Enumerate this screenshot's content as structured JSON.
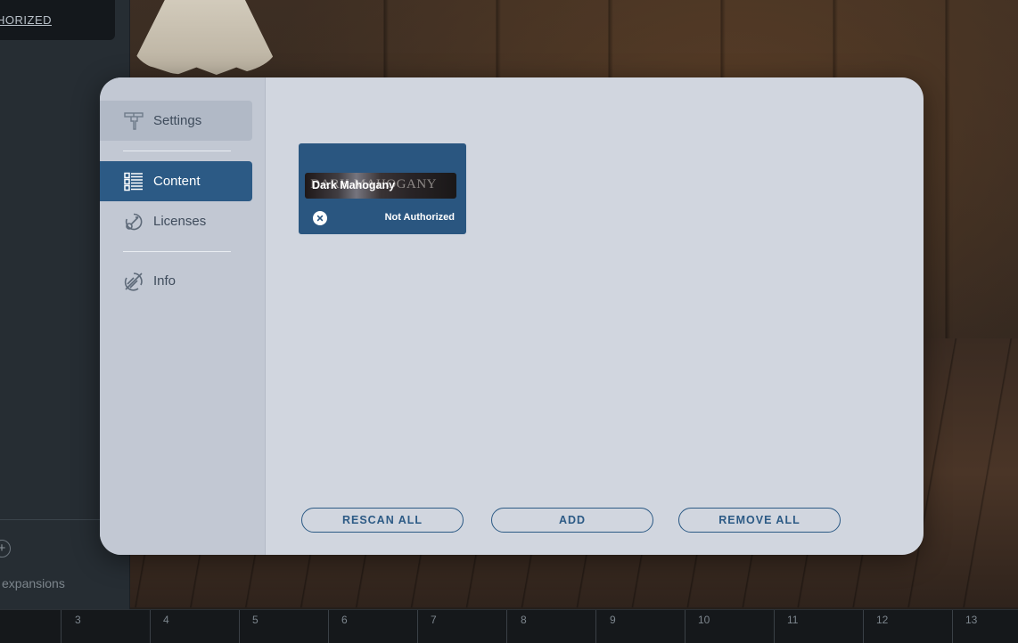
{
  "background": {
    "left_badge": "HORIZED",
    "expansions_label": "expansions",
    "plus_glyph": "+",
    "ruler_numbers": [
      "3",
      "4",
      "5",
      "6",
      "7",
      "8",
      "9",
      "10",
      "11",
      "12",
      "13"
    ]
  },
  "sidebar": {
    "items": [
      {
        "label": "Settings",
        "icon": "settings-icon",
        "state": "hover"
      },
      {
        "label": "Content",
        "icon": "content-list-icon",
        "state": "active"
      },
      {
        "label": "Licenses",
        "icon": "licenses-icon",
        "state": "normal"
      },
      {
        "label": "Info",
        "icon": "info-icon",
        "state": "normal"
      }
    ]
  },
  "content": {
    "cards": [
      {
        "title": "Dark Mahogany",
        "logo_text": "DARK MAHOGANY",
        "status": "Not Authorized",
        "status_icon": "close-icon"
      }
    ]
  },
  "actions": {
    "rescan_all": "RESCAN ALL",
    "add": "ADD",
    "remove_all": "REMOVE ALL"
  },
  "colors": {
    "accent": "#2c5a85",
    "modal_bg": "#d1d6df",
    "sidebar_bg": "#c2c8d3",
    "active_text": "#ffffff"
  }
}
